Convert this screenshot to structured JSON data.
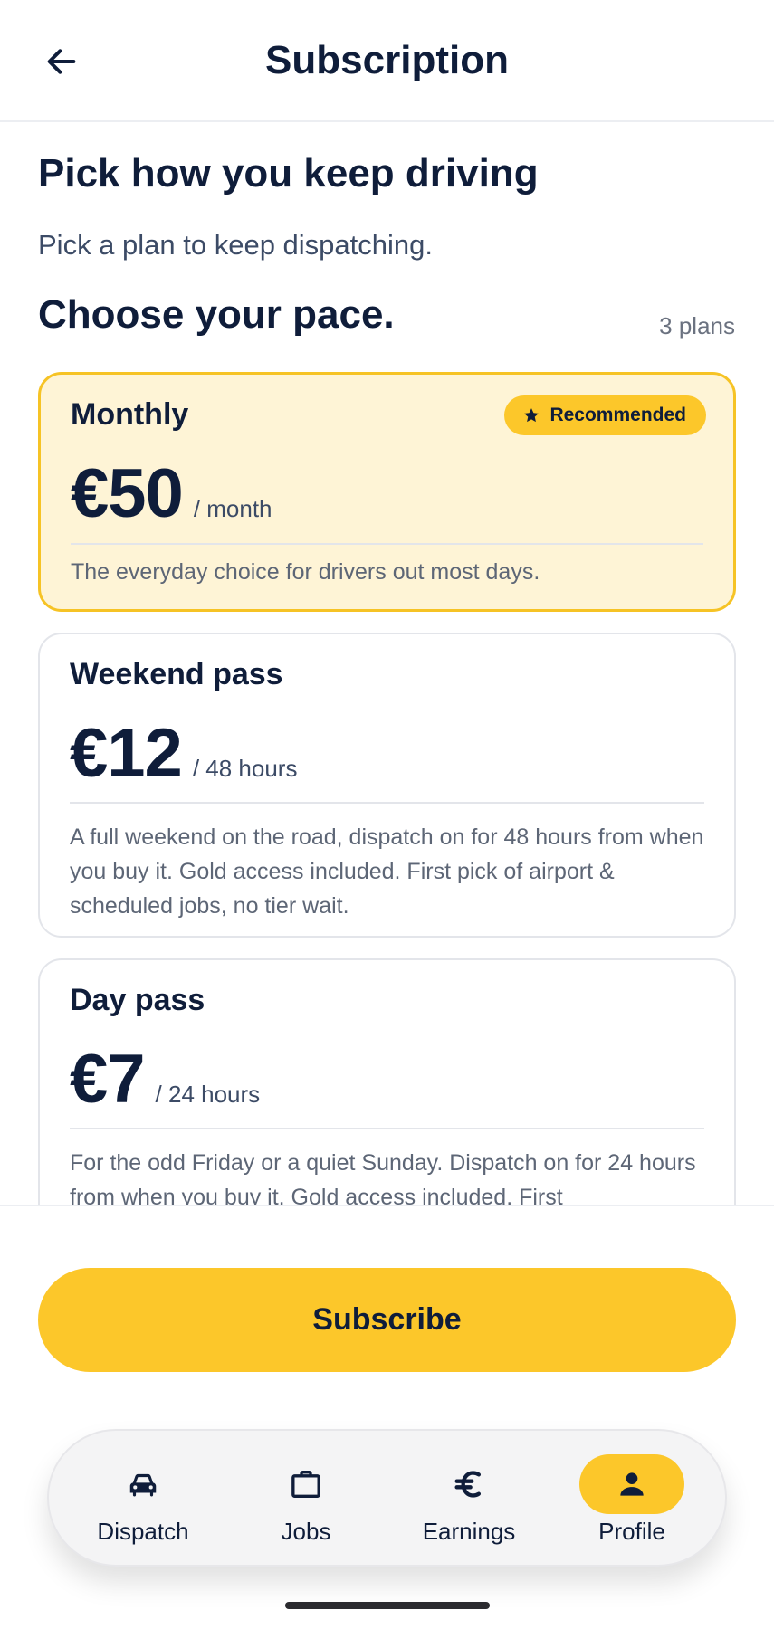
{
  "header": {
    "title": "Subscription",
    "back_icon": "arrow-left-icon"
  },
  "intro": {
    "heading": "Pick how you keep driving",
    "subtitle": "Pick a plan to keep dispatching."
  },
  "plans_section": {
    "title": "Choose your pace.",
    "count_label": "3 plans"
  },
  "plans": [
    {
      "name": "Monthly",
      "price": "€50",
      "period": "/ month",
      "description": "The everyday choice for drivers out most days.",
      "badge": "Recommended",
      "badge_icon": "star-icon",
      "selected": true
    },
    {
      "name": "Weekend pass",
      "price": "€12",
      "period": "/ 48 hours",
      "description": "A full weekend on the road, dispatch on for 48 hours from when you buy it. Gold access included. First pick of airport & scheduled jobs, no tier wait.",
      "selected": false
    },
    {
      "name": "Day pass",
      "price": "€7",
      "period": "/ 24 hours",
      "description": "For the odd Friday or a quiet Sunday. Dispatch on for 24 hours from when you buy it. Gold access included. First",
      "selected": false
    }
  ],
  "actions": {
    "subscribe_label": "Subscribe"
  },
  "nav": {
    "items": [
      {
        "label": "Dispatch",
        "icon": "car-icon",
        "active": false
      },
      {
        "label": "Jobs",
        "icon": "briefcase-icon",
        "active": false
      },
      {
        "label": "Earnings",
        "icon": "euro-icon",
        "active": false
      },
      {
        "label": "Profile",
        "icon": "person-icon",
        "active": true
      }
    ]
  },
  "colors": {
    "accent": "#fcc72a",
    "selected_card_bg": "#fef4d6",
    "text_primary": "#0f1d3a"
  }
}
